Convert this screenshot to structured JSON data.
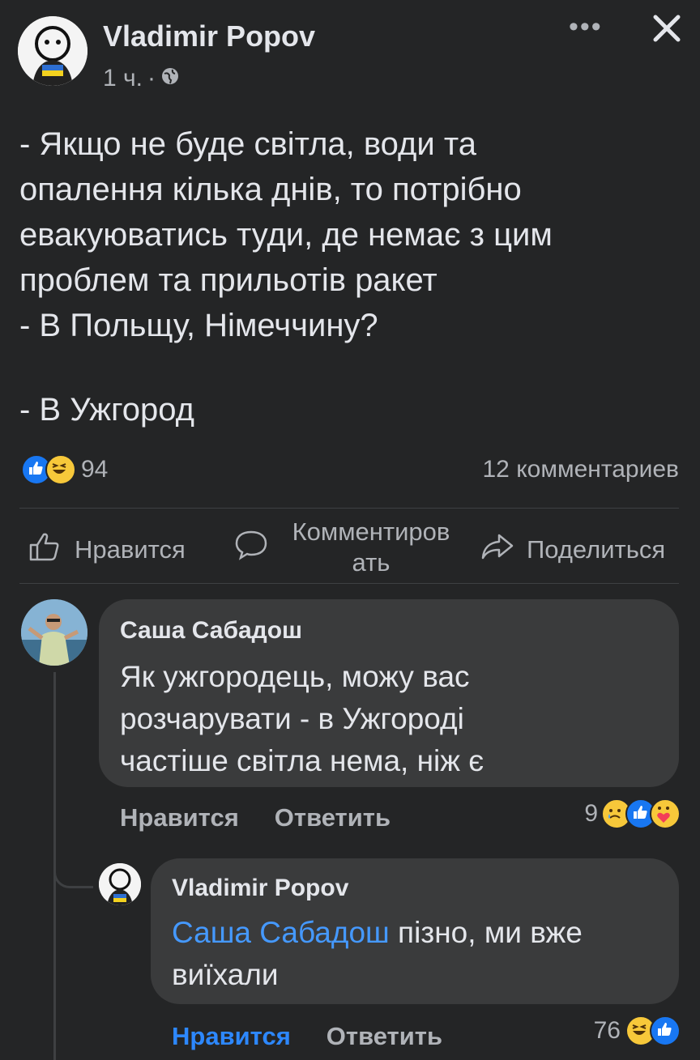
{
  "post": {
    "author": "Vladimir Popov",
    "time": "1 ч.",
    "separator": "·",
    "lines": [
      "- Якщо не буде світла, води та",
      "опалення кілька днів, то потрібно",
      "евакуюватись туди, де немає з цим",
      "проблем та прильотів ракет",
      "- В Польщу, Німеччину?",
      "- В Ужгород"
    ],
    "reactions_count": "94",
    "comments_count": "12 комментариев"
  },
  "actions": {
    "like": "Нравится",
    "comment_line1": "Комментиров",
    "comment_line2": "ать",
    "share": "Поделиться"
  },
  "comments": [
    {
      "author": "Саша Сабадош",
      "lines": [
        "Як ужгородець, можу вас",
        "розчарувати - в Ужгороді",
        "частіше світла нема, ніж є"
      ],
      "like_label": "Нравится",
      "reply_label": "Ответить",
      "reaction_count": "9"
    },
    {
      "author": "Vladimir Popov",
      "mention": "Саша Сабадош",
      "text_after_mention": " пізно, ми вже",
      "line2": "виїхали",
      "like_label": "Нравится",
      "reply_label": "Ответить",
      "reaction_count": "76"
    }
  ],
  "icons": {
    "more": "more-dots-icon",
    "close": "close-icon",
    "privacy": "globe-icon",
    "like": "thumbs-up-icon",
    "comment": "speech-bubble-icon",
    "share": "share-arrow-icon"
  },
  "colors": {
    "background": "#242526",
    "bubble": "#3a3b3c",
    "text": "#e4e6eb",
    "secondary_text": "#b0b3b8",
    "link": "#4599ff",
    "liked": "#2d88ff"
  }
}
